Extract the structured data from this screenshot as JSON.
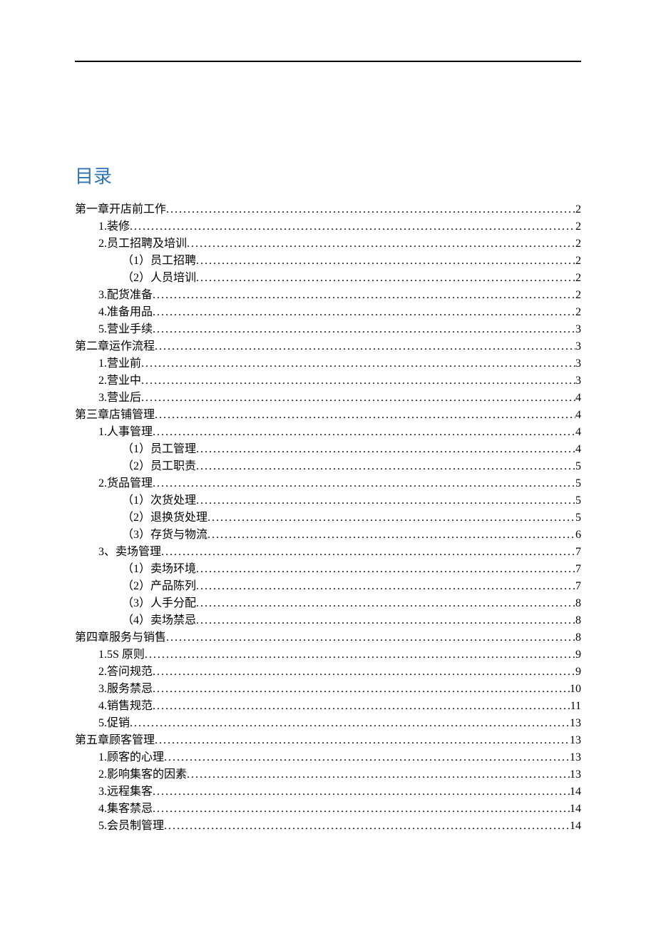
{
  "toc_title": "目录",
  "entries": [
    {
      "text": "第一章开店前工作",
      "page": "2",
      "indent": 0
    },
    {
      "text": "1.装修",
      "page": "2",
      "indent": 1
    },
    {
      "text": "2.员工招聘及培训",
      "page": "2",
      "indent": 1
    },
    {
      "text": "（1）员工招聘",
      "page": "2",
      "indent": 2
    },
    {
      "text": "（2）人员培训",
      "page": "2",
      "indent": 2
    },
    {
      "text": "3.配货准备",
      "page": "2",
      "indent": 1
    },
    {
      "text": "4.准备用品",
      "page": "2",
      "indent": 1
    },
    {
      "text": "5.营业手续",
      "page": "3",
      "indent": 1
    },
    {
      "text": "第二章运作流程",
      "page": "3",
      "indent": 0
    },
    {
      "text": "1.营业前",
      "page": "3",
      "indent": 1
    },
    {
      "text": "2.营业中",
      "page": "3",
      "indent": 1
    },
    {
      "text": "3.营业后",
      "page": "4",
      "indent": 1
    },
    {
      "text": "第三章店铺管理",
      "page": "4",
      "indent": 0
    },
    {
      "text": "1.人事管理",
      "page": "4",
      "indent": 1
    },
    {
      "text": "（1）员工管理",
      "page": "4",
      "indent": 2
    },
    {
      "text": "（2）员工职责",
      "page": "5",
      "indent": 2
    },
    {
      "text": "2.货品管理",
      "page": "5",
      "indent": 1
    },
    {
      "text": "（1）次货处理",
      "page": "5",
      "indent": 2
    },
    {
      "text": "（2）退换货处理",
      "page": "5",
      "indent": 2
    },
    {
      "text": "（3）存货与物流",
      "page": "6",
      "indent": 2
    },
    {
      "text": "3、卖场管理",
      "page": "7",
      "indent": 1
    },
    {
      "text": "（1）卖场环境",
      "page": "7",
      "indent": 2
    },
    {
      "text": "（2）产品陈列",
      "page": "7",
      "indent": 2
    },
    {
      "text": "（3）人手分配",
      "page": "8",
      "indent": 2
    },
    {
      "text": "（4）卖场禁忌",
      "page": "8",
      "indent": 2
    },
    {
      "text": "第四章服务与销售",
      "page": "8",
      "indent": 0
    },
    {
      "text": "1.5S 原则",
      "page": "9",
      "indent": 1
    },
    {
      "text": "2.答问规范",
      "page": "9",
      "indent": 1
    },
    {
      "text": "3.服务禁忌",
      "page": "10",
      "indent": 1
    },
    {
      "text": "4.销售规范",
      "page": "11",
      "indent": 1
    },
    {
      "text": "5.促销",
      "page": "13",
      "indent": 1
    },
    {
      "text": "第五章顾客管理",
      "page": "13",
      "indent": 0
    },
    {
      "text": "1.顾客的心理",
      "page": "13",
      "indent": 1
    },
    {
      "text": "2.影响集客的因素",
      "page": "13",
      "indent": 1
    },
    {
      "text": "3.远程集客",
      "page": "14",
      "indent": 1
    },
    {
      "text": "4.集客禁忌",
      "page": "14",
      "indent": 1
    },
    {
      "text": "5.会员制管理",
      "page": "14",
      "indent": 1
    }
  ]
}
